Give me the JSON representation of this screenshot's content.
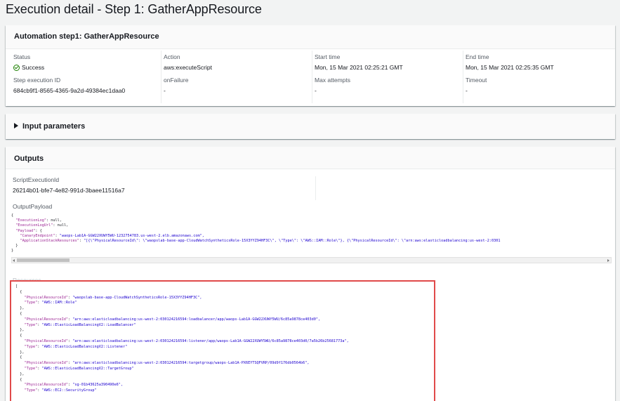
{
  "page_title": "Execution detail - Step 1: GatherAppResource",
  "step_panel": {
    "header": "Automation step1: GatherAppResource",
    "status_label": "Status",
    "status_value": "Success",
    "action_label": "Action",
    "action_value": "aws:executeScript",
    "start_label": "Start time",
    "start_value": "Mon, 15 Mar 2021 02:25:21 GMT",
    "end_label": "End time",
    "end_value": "Mon, 15 Mar 2021 02:25:35 GMT",
    "step_id_label": "Step execution ID",
    "step_id_value": "684cb9f1-8565-4365-9a2d-49384ec1daa0",
    "onfailure_label": "onFailure",
    "onfailure_value": "-",
    "max_attempts_label": "Max attempts",
    "max_attempts_value": "-",
    "timeout_label": "Timeout",
    "timeout_value": "-"
  },
  "input_panel": {
    "header": "Input parameters"
  },
  "outputs": {
    "header": "Outputs",
    "script_id_label": "ScriptExecutionId",
    "script_id_value": "26214b01-bfe7-4e82-991d-3baee11516a7",
    "payload_label": "OutputPayload",
    "payload_lines": [
      "{",
      "  \"ExecutionLog\": null,",
      "  \"ExecutionLogUrl\": null,",
      "  \"Payload\": {",
      "    \"CanaryEndpoint\": \"waops-Lab1A-GGW22XUWY5WU-1232754783.us-west-2.elb.amazonaws.com\",",
      "    \"ApplicationStackResources\": \"[{\\\"PhysicalResourceId\\\": \\\"waopslab-base-app-CloudWatchSyntheticsRole-15X3YYZ94HF3C\\\", \\\"Type\\\": \\\"AWS::IAM::Role\\\"}, {\\\"PhysicalResourceId\\\": \\\"arn:aws:elasticloadbalancing:us-west-2:0301",
      "  }",
      "}"
    ],
    "resources_label": "Resources",
    "resources_lines": [
      "[",
      "  {",
      "    \"PhysicalResourceId\": \"waopslab-base-app-CloudWatchSyntheticsRole-15X3YYZ94HF3C\",",
      "    \"Type\": \"AWS::IAM::Role\"",
      "  },",
      "  {",
      "    \"PhysicalResourceId\": \"arn:aws:elasticloadbalancing:us-west-2:030124216594:loadbalancer/app/waops-Lab1A-GGW22XUWY5WU/6c85a9878ce403d0\",",
      "    \"Type\": \"AWS::ElasticLoadBalancingV2::LoadBalancer\"",
      "  },",
      "  {",
      "    \"PhysicalResourceId\": \"arn:aws:elasticloadbalancing:us-west-2:030124216594:listener/app/waops-Lab1A-GGW22XUWY5WU/6c85a9878ce403d0/7a5b26b25681773a\",",
      "    \"Type\": \"AWS::ElasticLoadBalancingV2::Listener\"",
      "  },",
      "  {",
      "    \"PhysicalResourceId\": \"arn:aws:elasticloadbalancing:us-west-2:030124216594:targetgroup/waops-Lab1A-PX6EYTSQFVRP/09d9f176db0564b6\",",
      "    \"Type\": \"AWS::ElasticLoadBalancingV2::TargetGroup\"",
      "  },",
      "  {",
      "    \"PhysicalResourceId\": \"sg-01b43625a390490e6\",",
      "    \"Type\": \"AWS::EC2::SecurityGroup\""
    ]
  },
  "colors": {
    "success": "#1d8102",
    "highlight_border": "#e04a4a",
    "json_key": "#9b2393",
    "json_string": "#1c00cf"
  }
}
